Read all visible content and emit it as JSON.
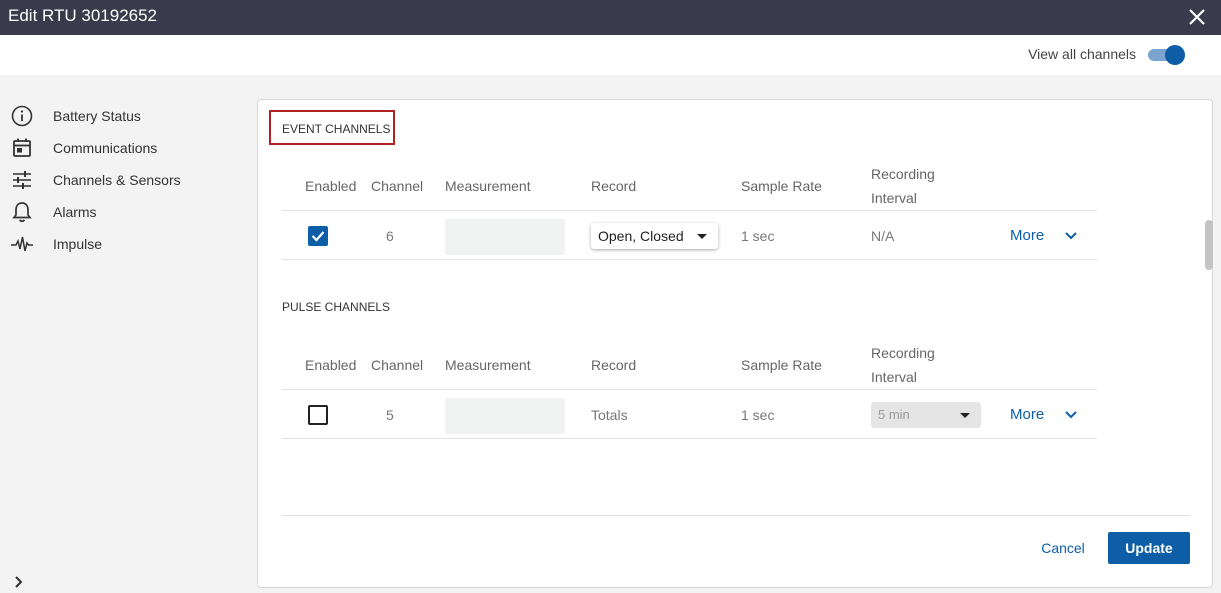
{
  "window": {
    "title": "Edit RTU 30192652"
  },
  "header": {
    "toggle_label": "View all channels",
    "toggle_on": true
  },
  "sidebar": {
    "items": [
      {
        "label": "Battery Status",
        "icon": "info-icon"
      },
      {
        "label": "Communications",
        "icon": "calendar-icon"
      },
      {
        "label": "Channels & Sensors",
        "icon": "sliders-icon"
      },
      {
        "label": "Alarms",
        "icon": "bell-icon"
      },
      {
        "label": "Impulse",
        "icon": "pulse-wave-icon"
      }
    ]
  },
  "columns": {
    "enabled": "Enabled",
    "channel": "Channel",
    "measurement": "Measurement",
    "record": "Record",
    "sample_rate": "Sample Rate",
    "recording_interval_1": "Recording",
    "recording_interval_2": "Interval"
  },
  "event_section": {
    "label": "EVENT CHANNELS",
    "row": {
      "enabled": true,
      "channel": "6",
      "measurement": "",
      "record": "Open, Closed",
      "sample_rate": "1 sec",
      "recording_interval": "N/A",
      "more": "More"
    }
  },
  "pulse_section": {
    "label": "PULSE CHANNELS",
    "row": {
      "enabled": false,
      "channel": "5",
      "measurement": "",
      "record": "Totals",
      "sample_rate": "1 sec",
      "recording_interval": "5 min",
      "more": "More"
    }
  },
  "footer": {
    "cancel": "Cancel",
    "update": "Update"
  },
  "colors": {
    "title_bar": "#393a4c",
    "accent": "#0d5ea6",
    "highlight_border": "#b22222"
  }
}
